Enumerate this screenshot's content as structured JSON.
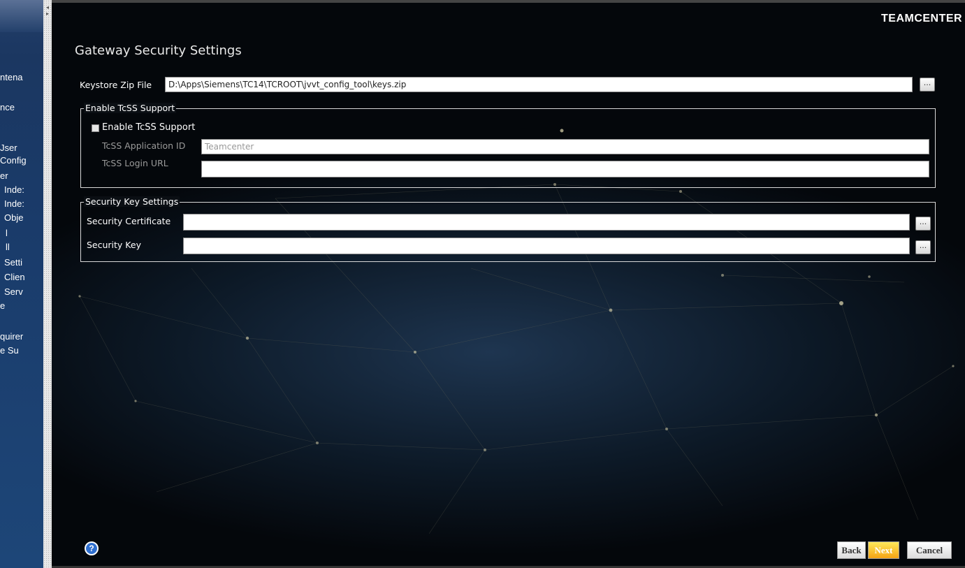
{
  "sidebar": {
    "items": [
      "ntena",
      "nce",
      "Jser",
      "Config",
      "er",
      "Inde:",
      "Inde:",
      "Obje",
      "l",
      "ll",
      "Setti",
      "Clien",
      "Serv",
      "e",
      "quirer",
      "e Su"
    ]
  },
  "header": {
    "brand": "TEAMCENTER",
    "page_title": "Gateway Security Settings"
  },
  "keystore": {
    "label": "Keystore Zip File",
    "value": "D:\\Apps\\Siemens\\TC14\\TCROOT\\jvvt_config_tool\\keys.zip",
    "browse_label": "..."
  },
  "tcss": {
    "group_title": "Enable TcSS Support",
    "checkbox_label": "Enable TcSS Support",
    "checked": false,
    "app_id_label": "TcSS Application ID",
    "app_id_value": "Teamcenter",
    "login_url_label": "TcSS Login URL",
    "login_url_value": ""
  },
  "security_keys": {
    "group_title": "Security Key Settings",
    "certificate_label": "Security Certificate",
    "certificate_value": "",
    "key_label": "Security Key",
    "key_value": "",
    "browse_label": "..."
  },
  "footer": {
    "help_label": "?",
    "back_label": "Back",
    "next_label": "Next",
    "cancel_label": "Cancel"
  },
  "colors": {
    "sidebar": "#1b3761",
    "next_button": "#f5a314",
    "help_icon": "#2f6fd0"
  }
}
